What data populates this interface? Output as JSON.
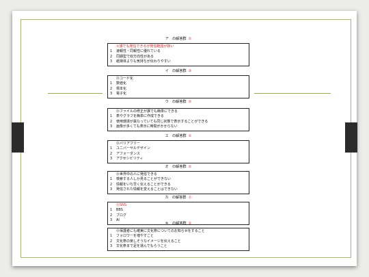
{
  "sections": [
    {
      "title": "ア　の解答群",
      "num": "①",
      "items": [
        {
          "n": "",
          "text": "①誰でも発信できるが発信範囲が狭い"
        },
        {
          "n": "1",
          "text": "速報性・同報性に優れている"
        },
        {
          "n": "2",
          "text": "同期型で双方向性がある"
        },
        {
          "n": "3",
          "text": "紙媒体よりも気持ちが伝わりやすい"
        }
      ]
    },
    {
      "title": "イ　の解答群",
      "num": "③",
      "items": [
        {
          "n": "",
          "text": "⓪コード化"
        },
        {
          "n": "1",
          "text": "数値化"
        },
        {
          "n": "2",
          "text": "標本化"
        },
        {
          "n": "3",
          "text": "電子化"
        }
      ]
    },
    {
      "title": "ウ　の解答群",
      "num": "②",
      "items": [
        {
          "n": "",
          "text": ""
        },
        {
          "n": "",
          "text": "⓪ファイルの修正が誰でも簡単にできる"
        },
        {
          "n": "1",
          "text": "表やグラフを簡単に作成できる"
        },
        {
          "n": "2",
          "text": "使用環境が異なっていても同じ状態で表示することができる"
        },
        {
          "n": "3",
          "text": "画像が多くても表示に時間がかからない"
        }
      ]
    },
    {
      "title": "エ　の解答群",
      "num": "①",
      "items": [
        {
          "n": "",
          "text": "⓪バリアフリー"
        },
        {
          "n": "1",
          "text": "ユニバーサルデザイン"
        },
        {
          "n": "2",
          "text": "アフォーダンス"
        },
        {
          "n": "3",
          "text": "アクセシビリティ"
        }
      ]
    },
    {
      "title": "オ　の解答群",
      "num": "①",
      "items": [
        {
          "n": "",
          "text": "⓪世界中の人に発信できる"
        },
        {
          "n": "1",
          "text": "検索する人しか見ることができない"
        },
        {
          "n": "2",
          "text": "情報をいち早く伝えることができる"
        },
        {
          "n": "3",
          "text": "発信された情報を変えることはできない"
        }
      ]
    },
    {
      "title": "カ　の解答群",
      "num": "⓪",
      "items": [
        {
          "n": "",
          "text": "⓪SNS"
        },
        {
          "n": "1",
          "text": "BBS"
        },
        {
          "n": "2",
          "text": "ブログ"
        },
        {
          "n": "3",
          "text": "AI"
        }
      ]
    },
    {
      "title": "キ　の解答群",
      "num": "②",
      "items": [
        {
          "n": "",
          "text": "⓪保護者にも確実に文化祭についてのお知らせをすること"
        },
        {
          "n": "1",
          "text": "フォロワーを増やすこと"
        },
        {
          "n": "2",
          "text": "文化祭の楽しそうなイメージを伝えること"
        },
        {
          "n": "3",
          "text": "文化祭まで足を運んでもらうこと"
        }
      ]
    }
  ]
}
